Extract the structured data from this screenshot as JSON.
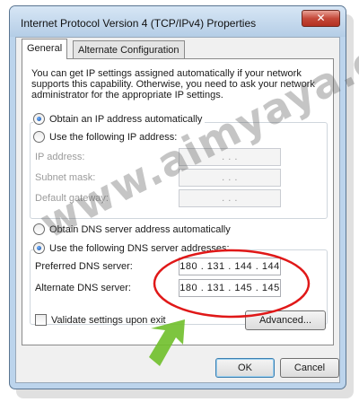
{
  "window": {
    "title": "Internet Protocol Version 4 (TCP/IPv4) Properties",
    "close_label": "✕"
  },
  "tabs": [
    {
      "label": "General",
      "active": true
    },
    {
      "label": "Alternate Configuration",
      "active": false
    }
  ],
  "description": "You can get IP settings assigned automatically if your network supports this capability. Otherwise, you need to ask your network administrator for the appropriate IP settings.",
  "ip": {
    "auto_label": "Obtain an IP address automatically",
    "manual_label": "Use the following IP address:",
    "selected": "auto",
    "fields": [
      {
        "label": "IP address:",
        "value": ".   .   ."
      },
      {
        "label": "Subnet mask:",
        "value": ".   .   ."
      },
      {
        "label": "Default gateway:",
        "value": ".   .   ."
      }
    ]
  },
  "dns": {
    "auto_label": "Obtain DNS server address automatically",
    "manual_label": "Use the following DNS server addresses:",
    "selected": "manual",
    "preferred_label": "Preferred DNS server:",
    "preferred_value": "180 . 131 . 144 . 144",
    "alternate_label": "Alternate DNS server:",
    "alternate_value": "180 . 131 . 145 . 145"
  },
  "validate_label": "Validate settings upon exit",
  "buttons": {
    "advanced": "Advanced...",
    "ok": "OK",
    "cancel": "Cancel"
  },
  "watermark": "www.aimyaya.com",
  "annotation_colors": {
    "circle": "#e01818",
    "arrow": "#6fbf2a"
  }
}
